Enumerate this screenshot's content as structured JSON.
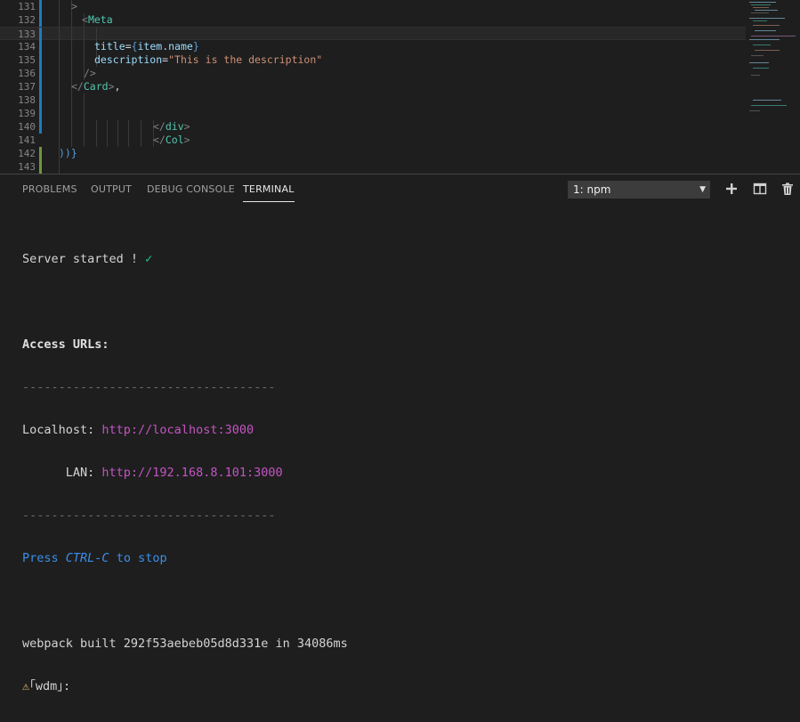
{
  "editor": {
    "lines": [
      {
        "num": "131",
        "code": [
          {
            "cls": "c-punc",
            "text": ">"
          }
        ]
      },
      {
        "num": "132",
        "code": [
          {
            "cls": "c-punc",
            "text": "<"
          },
          {
            "cls": "c-tag",
            "text": "Meta"
          }
        ]
      },
      {
        "num": "133",
        "code": []
      },
      {
        "num": "134",
        "code": [
          {
            "cls": "c-attr",
            "text": "title"
          },
          {
            "cls": "c-plain",
            "text": "="
          },
          {
            "cls": "c-brace",
            "text": "{"
          },
          {
            "cls": "c-attr",
            "text": "item.name"
          },
          {
            "cls": "c-brace",
            "text": "}"
          }
        ]
      },
      {
        "num": "135",
        "code": [
          {
            "cls": "c-attr",
            "text": "description"
          },
          {
            "cls": "c-plain",
            "text": "="
          },
          {
            "cls": "c-str",
            "text": "\"This is the description\""
          }
        ]
      },
      {
        "num": "136",
        "code": [
          {
            "cls": "c-punc",
            "text": "/>"
          }
        ]
      },
      {
        "num": "137",
        "code": [
          {
            "cls": "c-punc",
            "text": "</"
          },
          {
            "cls": "c-tag",
            "text": "Card"
          },
          {
            "cls": "c-punc",
            "text": ">"
          },
          {
            "cls": "c-plain",
            "text": ","
          }
        ]
      },
      {
        "num": "138",
        "code": []
      },
      {
        "num": "139",
        "code": []
      },
      {
        "num": "140",
        "code": [
          {
            "cls": "c-punc",
            "text": "</"
          },
          {
            "cls": "c-tag",
            "text": "div"
          },
          {
            "cls": "c-punc",
            "text": ">"
          }
        ]
      },
      {
        "num": "141",
        "code": [
          {
            "cls": "c-punc",
            "text": "</"
          },
          {
            "cls": "c-tag",
            "text": "Col"
          },
          {
            "cls": "c-punc",
            "text": ">"
          }
        ]
      },
      {
        "num": "142",
        "code": [
          {
            "cls": "c-brace",
            "text": "))"
          },
          {
            "cls": "c-brace",
            "text": "}"
          }
        ]
      },
      {
        "num": "143",
        "code": []
      }
    ]
  },
  "panel": {
    "tabs": [
      "PROBLEMS",
      "OUTPUT",
      "DEBUG CONSOLE",
      "TERMINAL"
    ],
    "active_tab": "TERMINAL",
    "terminal_select": "1: npm",
    "actions": {
      "new": "add-terminal-icon",
      "split": "split-terminal-icon",
      "kill": "trash-icon"
    }
  },
  "terminal": {
    "server_started": "Server started ! ",
    "check": "✓",
    "access_urls": "Access URLs:",
    "divider": "-----------------------------------",
    "localhost_label": "Localhost: ",
    "localhost_url": "http://localhost:3000",
    "lan_label": "      LAN: ",
    "lan_url": "http://192.168.8.101:3000",
    "press": "Press ",
    "ctrlc": "CTRL-C",
    "to_stop": " to stop",
    "webpack": "webpack built 292f53aebeb05d8d331e in 34086ms",
    "warn_icon": "⚠",
    "wdm": "｢wdm｣:"
  },
  "colors": {
    "accent_bar_blue": "#1e7bbf",
    "accent_bar_green": "#6a9a3a",
    "url": "#c355c3",
    "check": "#23d18b",
    "hint": "#3b8eea"
  }
}
